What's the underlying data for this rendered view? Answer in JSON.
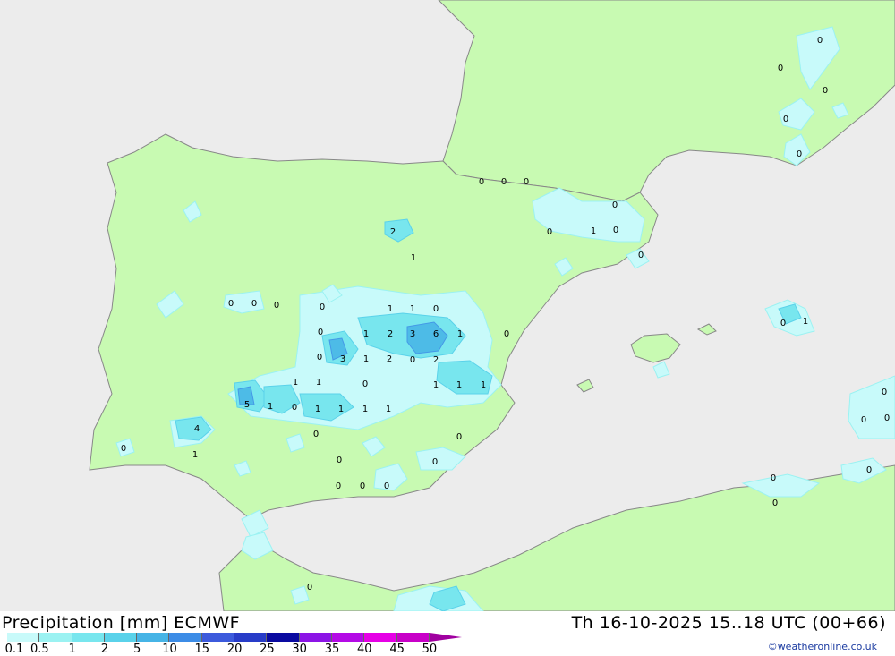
{
  "title": "Precipitation [mm] ECMWF",
  "timestamp": "Th 16-10-2025 15..18 UTC (00+66)",
  "credit": "©weatheronline.co.uk",
  "colors": {
    "sea": "#ececec",
    "land": "#c8fab2",
    "coast": "#888888"
  },
  "legend": {
    "labels": [
      "0.1",
      "0.5",
      "1",
      "2",
      "5",
      "10",
      "15",
      "20",
      "25",
      "30",
      "35",
      "40",
      "45",
      "50"
    ],
    "colors": [
      "#c8fafa",
      "#9bf2f2",
      "#78e6ee",
      "#5ad2ea",
      "#46b4e6",
      "#3c8ce6",
      "#3c5adc",
      "#283cc8",
      "#0a0aa0",
      "#8c14e6",
      "#b40ae6",
      "#e600e6",
      "#c800c8"
    ],
    "arrow_color": "#a000a0"
  },
  "values": [
    {
      "t": "0"
    },
    {
      "t": "0"
    },
    {
      "t": "0"
    },
    {
      "t": "0"
    },
    {
      "t": "0"
    },
    {
      "t": "0"
    },
    {
      "t": "0"
    },
    {
      "t": "0"
    },
    {
      "t": "0"
    },
    {
      "t": "1"
    },
    {
      "t": "0"
    },
    {
      "t": "0"
    },
    {
      "t": "2"
    },
    {
      "t": "1"
    },
    {
      "t": "0"
    },
    {
      "t": "0"
    },
    {
      "t": "0"
    },
    {
      "t": "0"
    },
    {
      "t": "1"
    },
    {
      "t": "1"
    },
    {
      "t": "0"
    },
    {
      "t": "0"
    },
    {
      "t": "1"
    },
    {
      "t": "2"
    },
    {
      "t": "3"
    },
    {
      "t": "6"
    },
    {
      "t": "1"
    },
    {
      "t": "0"
    },
    {
      "t": "0"
    },
    {
      "t": "3"
    },
    {
      "t": "1"
    },
    {
      "t": "2"
    },
    {
      "t": "0"
    },
    {
      "t": "2"
    },
    {
      "t": "1"
    },
    {
      "t": "1"
    },
    {
      "t": "0"
    },
    {
      "t": "1"
    },
    {
      "t": "1"
    },
    {
      "t": "1"
    },
    {
      "t": "5"
    },
    {
      "t": "1"
    },
    {
      "t": "0"
    },
    {
      "t": "1"
    },
    {
      "t": "1"
    },
    {
      "t": "1"
    },
    {
      "t": "1"
    },
    {
      "t": "4"
    },
    {
      "t": "1"
    },
    {
      "t": "0"
    },
    {
      "t": "0"
    },
    {
      "t": "0"
    },
    {
      "t": "0"
    },
    {
      "t": "0"
    },
    {
      "t": "0"
    },
    {
      "t": "0"
    },
    {
      "t": "0"
    },
    {
      "t": "0"
    },
    {
      "t": "0"
    },
    {
      "t": "1"
    },
    {
      "t": "0"
    },
    {
      "t": "0"
    },
    {
      "t": "0"
    },
    {
      "t": "0"
    },
    {
      "t": "0"
    },
    {
      "t": "0"
    },
    {
      "t": "0"
    }
  ]
}
